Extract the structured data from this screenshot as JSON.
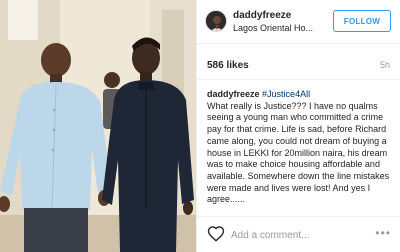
{
  "post": {
    "username": "daddyfreeze",
    "location": "Lagos Oriental Ho...",
    "follow_label": "FOLLOW",
    "likes": "586 likes",
    "time_ago": "5h",
    "caption_user": "daddyfreeze",
    "caption_hashtag": "#Justice4All",
    "caption_body": "What really is Justice??? I have no qualms seeing a young man who committed a crime pay for that crime. Life is sad, before Richard came along, you could not dream of buying a house in LEKKI for 20million naira, his dream was to make choice housing affordable and available. Somewhere down the line mistakes were made and lives were lost! And yes I agree......",
    "comment_placeholder": "Add a comment...",
    "more_label": "•••"
  },
  "icons": {
    "like": "heart-icon",
    "options": "more-options-icon",
    "avatar": "avatar"
  },
  "colors": {
    "accent": "#3897f0",
    "text": "#262626",
    "muted": "#999999",
    "hashtag": "#003569",
    "border": "#efefef"
  }
}
